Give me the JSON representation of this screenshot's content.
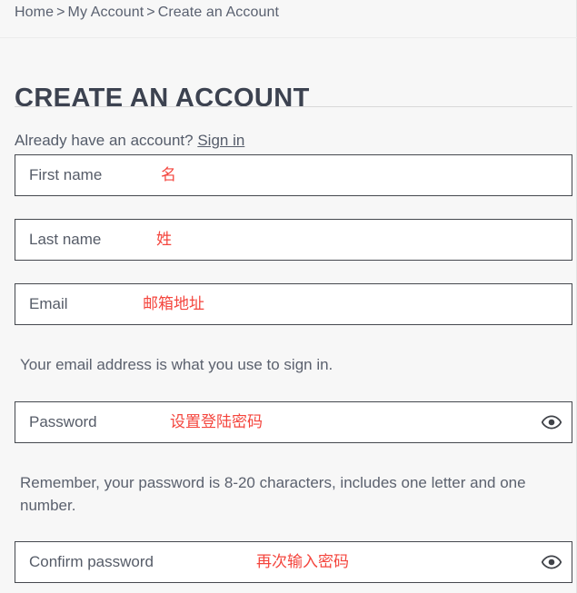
{
  "breadcrumb": {
    "items": [
      "Home",
      "My Account",
      "Create an Account"
    ],
    "separator": ">"
  },
  "page_title": "CREATE AN ACCOUNT",
  "signin_prompt": {
    "text": "Already have an account?",
    "link_label": "Sign in"
  },
  "form": {
    "fields": [
      {
        "label": "First name",
        "annotation": "名",
        "has_eye_toggle": false
      },
      {
        "label": "Last name",
        "annotation": "姓",
        "has_eye_toggle": false
      },
      {
        "label": "Email",
        "annotation": "邮箱地址",
        "has_eye_toggle": false
      },
      {
        "label": "Password",
        "annotation": "设置登陆密码",
        "has_eye_toggle": true
      },
      {
        "label": "Confirm password",
        "annotation": "再次输入密码",
        "has_eye_toggle": true
      }
    ],
    "email_helper": "Your email address is what you use to sign in.",
    "password_helper": "Remember, your password is 8-20 characters, includes one letter and one number."
  },
  "icons": {
    "eye": "eye-icon"
  },
  "colors": {
    "background": "#f7f7f7",
    "text": "#555c6a",
    "heading": "#3c4250",
    "annotation_red": "#f4453d",
    "field_border": "#45484e",
    "field_fill": "#ffffff",
    "rule": "#d9d9d9"
  }
}
